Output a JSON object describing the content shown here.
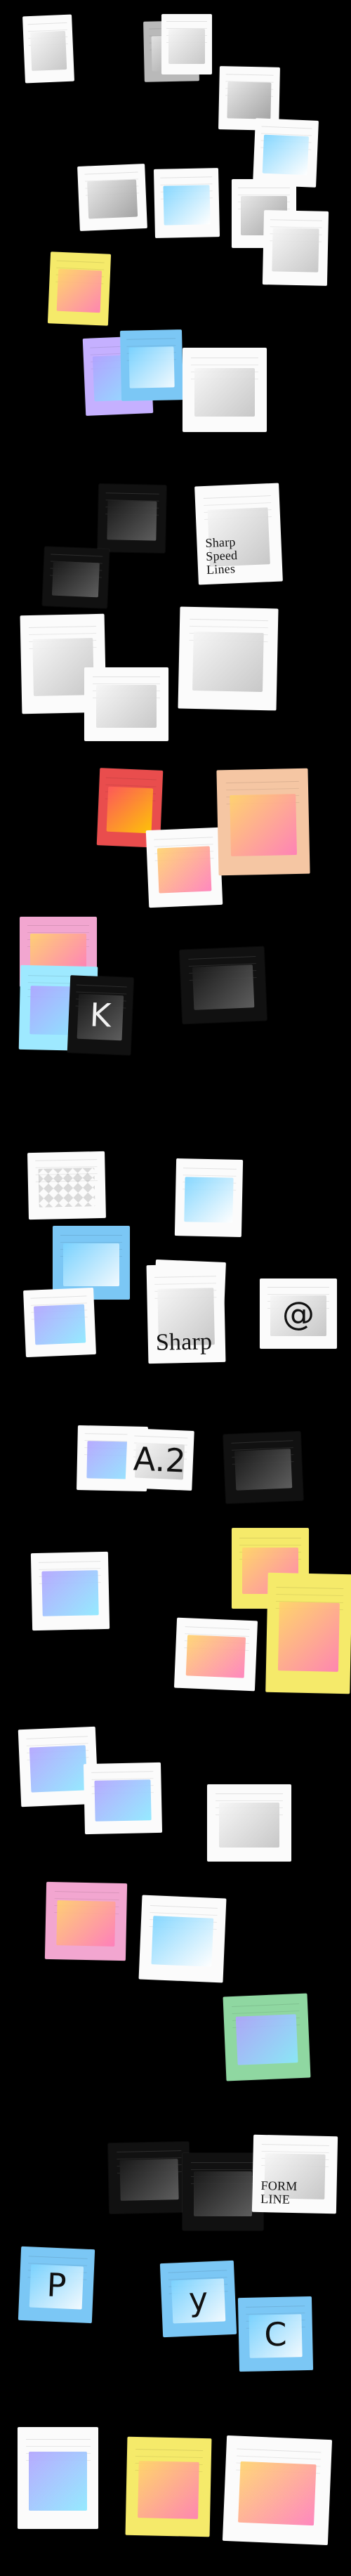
{
  "page": {
    "background": "#000000"
  },
  "cards": [
    {
      "id": "c1",
      "style": "white",
      "gfx": "grad7",
      "caption": "",
      "glyph": ""
    },
    {
      "id": "c2",
      "style": "gray",
      "gfx": "grad1",
      "caption": "",
      "glyph": ""
    },
    {
      "id": "c3",
      "style": "white",
      "gfx": "grad7",
      "caption": "",
      "glyph": ""
    },
    {
      "id": "c4",
      "style": "white",
      "gfx": "grad1",
      "caption": "",
      "glyph": ""
    },
    {
      "id": "c5",
      "style": "white",
      "gfx": "grad2",
      "caption": "",
      "glyph": ""
    },
    {
      "id": "c6",
      "style": "white",
      "gfx": "grad1",
      "caption": "",
      "glyph": ""
    },
    {
      "id": "c7",
      "style": "white",
      "gfx": "grad2",
      "caption": "",
      "glyph": ""
    },
    {
      "id": "c8",
      "style": "white",
      "gfx": "grad1",
      "caption": "",
      "glyph": ""
    },
    {
      "id": "c9",
      "style": "white",
      "gfx": "grad7",
      "caption": "",
      "glyph": ""
    },
    {
      "id": "c10",
      "style": "yellow",
      "gfx": "grad3",
      "caption": "",
      "glyph": ""
    },
    {
      "id": "c11",
      "style": "lilac",
      "gfx": "grad4",
      "caption": "",
      "glyph": ""
    },
    {
      "id": "c12",
      "style": "blue",
      "gfx": "grad2",
      "caption": "",
      "glyph": ""
    },
    {
      "id": "c13",
      "style": "white",
      "gfx": "grad7",
      "caption": "",
      "glyph": ""
    },
    {
      "id": "c14",
      "style": "black",
      "gfx": "grad6",
      "caption": "",
      "glyph": ""
    },
    {
      "id": "c15",
      "style": "black",
      "gfx": "grad6",
      "caption": "",
      "glyph": ""
    },
    {
      "id": "c16",
      "style": "white",
      "gfx": "grad7",
      "caption": "Sharp\nSpeed\nLines",
      "glyph": ""
    },
    {
      "id": "c17",
      "style": "white",
      "gfx": "grad7",
      "caption": "",
      "glyph": ""
    },
    {
      "id": "c18",
      "style": "white",
      "gfx": "grad7",
      "caption": "",
      "glyph": ""
    },
    {
      "id": "c19",
      "style": "white",
      "gfx": "grad7",
      "caption": "",
      "glyph": ""
    },
    {
      "id": "c20",
      "style": "red",
      "gfx": "grad5",
      "caption": "",
      "glyph": ""
    },
    {
      "id": "c21",
      "style": "white",
      "gfx": "grad3",
      "caption": "",
      "glyph": ""
    },
    {
      "id": "c22",
      "style": "peach",
      "gfx": "grad3",
      "caption": "",
      "glyph": ""
    },
    {
      "id": "c23",
      "style": "pink",
      "gfx": "grad3",
      "caption": "",
      "glyph": ""
    },
    {
      "id": "c24",
      "style": "cyan",
      "gfx": "grad4",
      "caption": "",
      "glyph": ""
    },
    {
      "id": "c25",
      "style": "black",
      "gfx": "grad6",
      "caption": "",
      "glyph": "K"
    },
    {
      "id": "c26",
      "style": "black",
      "gfx": "grad6",
      "caption": "",
      "glyph": ""
    },
    {
      "id": "c27",
      "style": "white",
      "gfx": "checker",
      "caption": "",
      "glyph": ""
    },
    {
      "id": "c28",
      "style": "blue",
      "gfx": "grad2",
      "caption": "",
      "glyph": ""
    },
    {
      "id": "c29",
      "style": "white",
      "gfx": "grad2",
      "caption": "",
      "glyph": ""
    },
    {
      "id": "c30",
      "style": "white",
      "gfx": "grad7",
      "caption": "",
      "glyph": ""
    },
    {
      "id": "c31",
      "style": "white",
      "gfx": "grad4",
      "caption": "",
      "glyph": ""
    },
    {
      "id": "c32",
      "style": "white",
      "gfx": "grad7",
      "caption": "Sharp",
      "glyph": ""
    },
    {
      "id": "c33",
      "style": "white",
      "gfx": "grad7",
      "caption": "",
      "glyph": "@"
    },
    {
      "id": "c34",
      "style": "white",
      "gfx": "grad4",
      "caption": "",
      "glyph": ""
    },
    {
      "id": "c35",
      "style": "white",
      "gfx": "grad7",
      "caption": "",
      "glyph": "A.2"
    },
    {
      "id": "c36",
      "style": "black",
      "gfx": "grad6",
      "caption": "",
      "glyph": ""
    },
    {
      "id": "c37",
      "style": "white",
      "gfx": "grad4",
      "caption": "",
      "glyph": ""
    },
    {
      "id": "c38",
      "style": "yellow",
      "gfx": "grad3",
      "caption": "",
      "glyph": ""
    },
    {
      "id": "c39",
      "style": "yellow",
      "gfx": "grad3",
      "caption": "",
      "glyph": ""
    },
    {
      "id": "c40",
      "style": "white",
      "gfx": "grad3",
      "caption": "",
      "glyph": ""
    },
    {
      "id": "c41",
      "style": "white",
      "gfx": "grad4",
      "caption": "",
      "glyph": ""
    },
    {
      "id": "c42",
      "style": "white",
      "gfx": "grad4",
      "caption": "",
      "glyph": ""
    },
    {
      "id": "c43",
      "style": "white",
      "gfx": "grad7",
      "caption": "",
      "glyph": ""
    },
    {
      "id": "c44",
      "style": "pink",
      "gfx": "grad3",
      "caption": "",
      "glyph": ""
    },
    {
      "id": "c45",
      "style": "white",
      "gfx": "grad2",
      "caption": "",
      "glyph": ""
    },
    {
      "id": "c46",
      "style": "green",
      "gfx": "grad4",
      "caption": "",
      "glyph": ""
    },
    {
      "id": "c47",
      "style": "black",
      "gfx": "grad6",
      "caption": "",
      "glyph": ""
    },
    {
      "id": "c48",
      "style": "black",
      "gfx": "grad6",
      "caption": "",
      "glyph": ""
    },
    {
      "id": "c49",
      "style": "white",
      "gfx": "grad7",
      "caption": "FORM\nLINE",
      "glyph": ""
    },
    {
      "id": "c50",
      "style": "blue",
      "gfx": "grad2",
      "caption": "",
      "glyph": "P"
    },
    {
      "id": "c51",
      "style": "blue",
      "gfx": "grad2",
      "caption": "",
      "glyph": "y"
    },
    {
      "id": "c52",
      "style": "blue",
      "gfx": "grad2",
      "caption": "",
      "glyph": "C"
    },
    {
      "id": "c53",
      "style": "white",
      "gfx": "grad4",
      "caption": "",
      "glyph": ""
    },
    {
      "id": "c54",
      "style": "yellow",
      "gfx": "grad3",
      "caption": "",
      "glyph": ""
    },
    {
      "id": "c55",
      "style": "white",
      "gfx": "grad3",
      "caption": "",
      "glyph": ""
    }
  ]
}
